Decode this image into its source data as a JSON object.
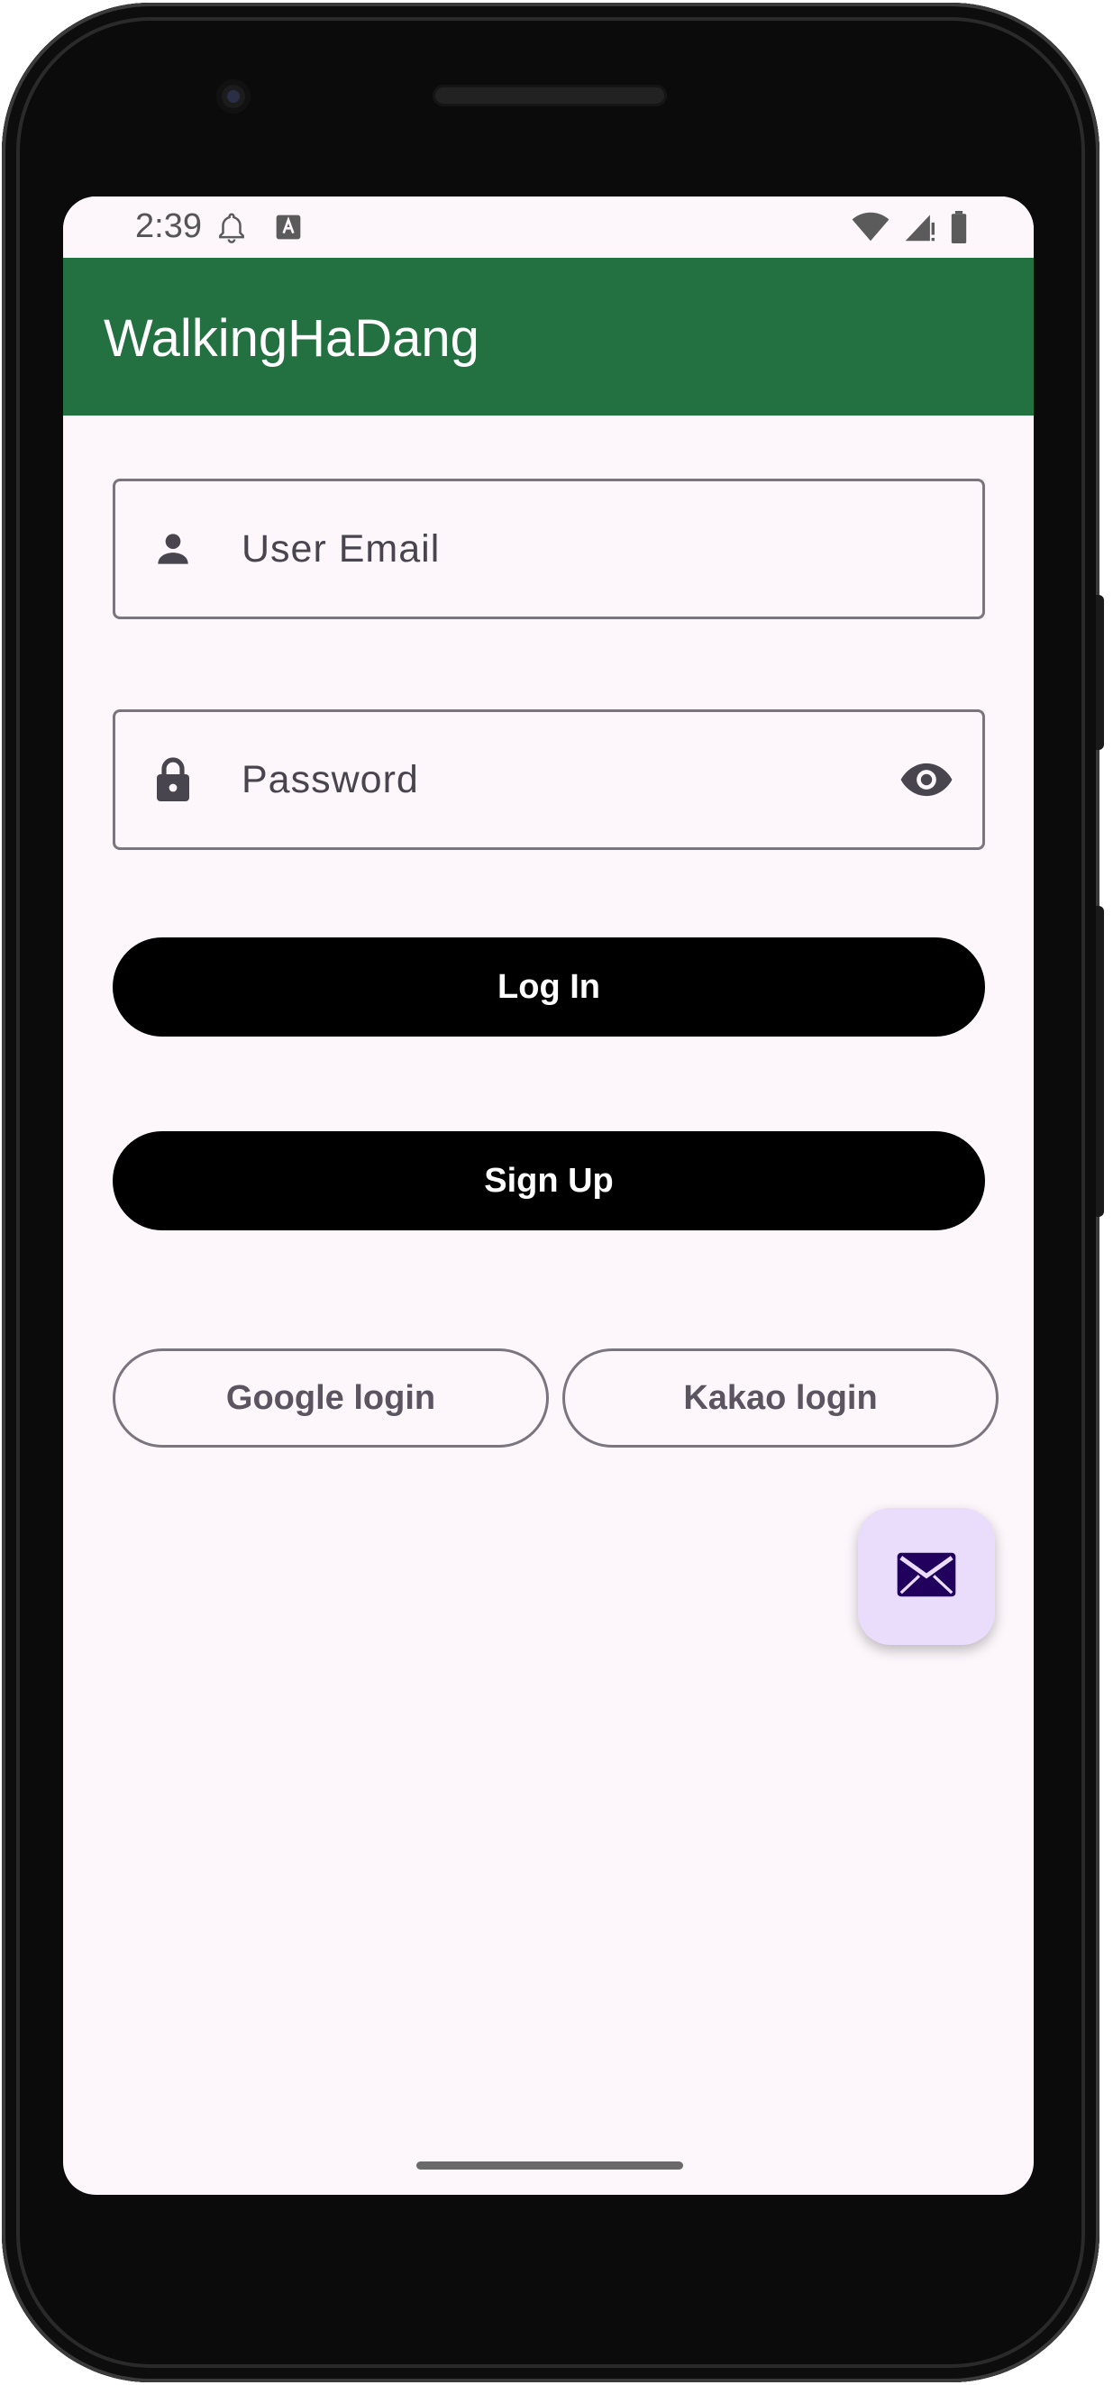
{
  "status_bar": {
    "time": "2:39",
    "icons": [
      "bell-outline-icon",
      "keyboard-a-icon",
      "wifi-icon",
      "cell-signal-icon",
      "battery-icon"
    ]
  },
  "app_bar": {
    "title": "WalkingHaDang",
    "color": "#237140"
  },
  "form": {
    "email_placeholder": "User Email",
    "email_icon": "person-icon",
    "password_placeholder": "Password",
    "password_icon": "lock-icon",
    "password_toggle_icon": "eye-icon"
  },
  "buttons": {
    "login_label": "Log In",
    "signup_label": "Sign Up",
    "google_label": "Google login",
    "kakao_label": "Kakao login"
  },
  "fab": {
    "icon": "envelope-icon",
    "background": "#e9ddfb",
    "icon_color": "#21005d"
  }
}
